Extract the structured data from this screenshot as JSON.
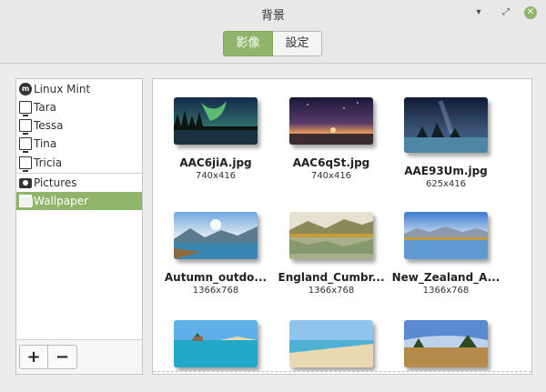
{
  "window": {
    "title": "背景"
  },
  "toolbar": {
    "tabs": [
      {
        "label": "影像",
        "active": true
      },
      {
        "label": "設定",
        "active": false
      }
    ]
  },
  "colors": {
    "accent": "#8fb56a"
  },
  "sidebar": {
    "items": [
      {
        "label": "Linux Mint",
        "icon": "linux-mint-logo-icon"
      },
      {
        "label": "Tara",
        "icon": "monitor-icon"
      },
      {
        "label": "Tessa",
        "icon": "monitor-icon"
      },
      {
        "label": "Tina",
        "icon": "monitor-icon"
      },
      {
        "label": "Tricia",
        "icon": "monitor-icon"
      },
      {
        "label": "Pictures",
        "icon": "camera-icon"
      },
      {
        "label": "Wallpaper",
        "icon": "folder-icon",
        "selected": true
      }
    ],
    "add_label": "+",
    "remove_label": "−"
  },
  "gallery": {
    "items": [
      {
        "name": "AAC6jiA.jpg",
        "size": "740x416"
      },
      {
        "name": "AAC6qSt.jpg",
        "size": "740x416"
      },
      {
        "name": "AAE93Um.jpg",
        "size": "625x416"
      },
      {
        "name": "Autumn_outdo...",
        "size": "1366x768"
      },
      {
        "name": "England_Cumbr...",
        "size": "1366x768"
      },
      {
        "name": "New_Zealand_A...",
        "size": "1366x768"
      },
      {
        "name": "",
        "size": ""
      },
      {
        "name": "",
        "size": ""
      },
      {
        "name": "",
        "size": ""
      }
    ]
  }
}
